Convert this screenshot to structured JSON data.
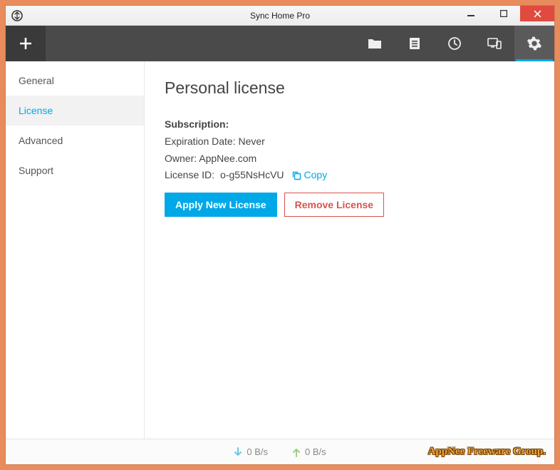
{
  "window": {
    "title": "Sync Home Pro"
  },
  "sidebar": {
    "items": [
      {
        "label": "General"
      },
      {
        "label": "License"
      },
      {
        "label": "Advanced"
      },
      {
        "label": "Support"
      }
    ]
  },
  "content": {
    "heading": "Personal license",
    "subscription_label": "Subscription:",
    "expiration_label": "Expiration Date:",
    "expiration_value": "Never",
    "owner_label": "Owner:",
    "owner_value": "AppNee.com",
    "license_id_label": "License ID:",
    "license_id_value": "o-g55NsHcVU",
    "copy_label": "Copy",
    "apply_button": "Apply New License",
    "remove_button": "Remove License"
  },
  "statusbar": {
    "down_rate": "0 B/s",
    "up_rate": "0 B/s"
  },
  "watermark": "AppNee Freeware Group."
}
